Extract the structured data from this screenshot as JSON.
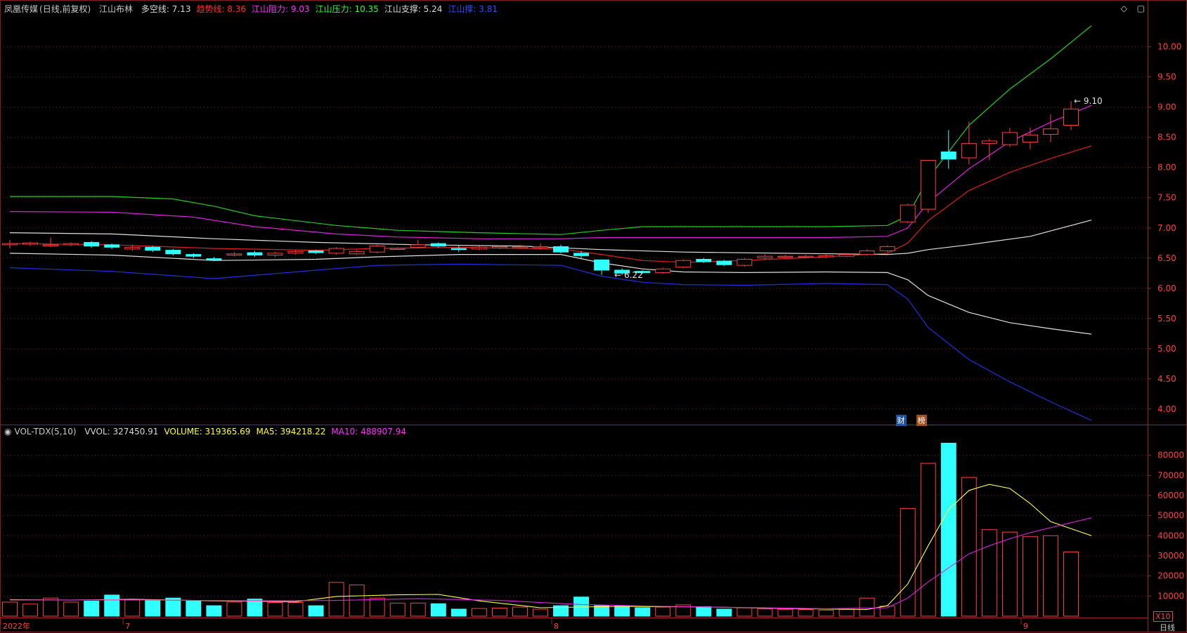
{
  "header": {
    "stock_name": "凤凰传媒",
    "period_mode": "(日线,前复权)",
    "indicator_name": "江山布林",
    "items": [
      {
        "label": "多空线:",
        "value": "7.13",
        "color": "#d8d8d8"
      },
      {
        "label": "趋势线:",
        "value": "8.36",
        "color": "#ff3030"
      },
      {
        "label": "江山阻力:",
        "value": "9.03",
        "color": "#ff30ff"
      },
      {
        "label": "江山压力:",
        "value": "10.35",
        "color": "#30ff30"
      },
      {
        "label": "江山支撑:",
        "value": "5.24",
        "color": "#d8d8d8"
      },
      {
        "label": "江山撑:",
        "value": "3.81",
        "color": "#3050ff"
      }
    ]
  },
  "vol_header": {
    "name": "VOL-TDX(5,10)",
    "items": [
      {
        "label": "VVOL:",
        "value": "327450.91",
        "color": "#d8d8d8"
      },
      {
        "label": "VOLUME:",
        "value": "319365.69",
        "color": "#ffff30"
      },
      {
        "label": "MA5:",
        "value": "394218.22",
        "color": "#ffff30"
      },
      {
        "label": "MA10:",
        "value": "488907.94",
        "color": "#ff30ff"
      }
    ]
  },
  "icons": {
    "diamond": "diamond-icon",
    "window": "restore-window-icon"
  },
  "colors": {
    "up": "#ff4040",
    "down": "#30ffff",
    "grid": "#802020",
    "axis_text": "#ff4040"
  },
  "main_axis": {
    "ticks": [
      "10.00",
      "9.50",
      "9.00",
      "8.50",
      "8.00",
      "7.50",
      "7.00",
      "6.50",
      "6.00",
      "5.50",
      "5.00",
      "4.50",
      "4.00"
    ],
    "min": 3.8,
    "max": 10.45
  },
  "vol_axis": {
    "ticks": [
      "80000",
      "70000",
      "60000",
      "50000",
      "40000",
      "30000",
      "20000",
      "10000"
    ],
    "max": 90000,
    "unit_label": "X10"
  },
  "x_axis": {
    "labels": [
      {
        "text": "2022年",
        "bar": 0
      },
      {
        "text": "7",
        "bar": 6
      },
      {
        "text": "8",
        "bar": 27
      },
      {
        "text": "9",
        "bar": 50
      }
    ]
  },
  "period_label": "日线",
  "annotations": {
    "high": "9.10",
    "low": "6.22"
  },
  "event_badges": [
    {
      "text": "财",
      "bar": 43
    },
    {
      "text": "榜",
      "bar": 44
    }
  ],
  "chart_data": {
    "type": "candlestick",
    "bars": [
      {
        "o": 6.72,
        "c": 6.74,
        "h": 6.8,
        "l": 6.66,
        "v": 7000
      },
      {
        "o": 6.73,
        "c": 6.75,
        "h": 6.77,
        "l": 6.7,
        "v": 6000
      },
      {
        "o": 6.72,
        "c": 6.72,
        "h": 6.84,
        "l": 6.68,
        "v": 9000
      },
      {
        "o": 6.72,
        "c": 6.74,
        "h": 6.76,
        "l": 6.7,
        "v": 7000
      },
      {
        "o": 6.76,
        "c": 6.7,
        "h": 6.78,
        "l": 6.67,
        "v": 7500
      },
      {
        "o": 6.72,
        "c": 6.68,
        "h": 6.74,
        "l": 6.65,
        "v": 10500
      },
      {
        "o": 6.65,
        "c": 6.68,
        "h": 6.72,
        "l": 6.62,
        "v": 8000
      },
      {
        "o": 6.68,
        "c": 6.63,
        "h": 6.7,
        "l": 6.6,
        "v": 7800
      },
      {
        "o": 6.63,
        "c": 6.57,
        "h": 6.65,
        "l": 6.54,
        "v": 9000
      },
      {
        "o": 6.56,
        "c": 6.53,
        "h": 6.58,
        "l": 6.5,
        "v": 7600
      },
      {
        "o": 6.49,
        "c": 6.48,
        "h": 6.52,
        "l": 6.45,
        "v": 5200
      },
      {
        "o": 6.55,
        "c": 6.57,
        "h": 6.6,
        "l": 6.53,
        "v": 7000
      },
      {
        "o": 6.59,
        "c": 6.55,
        "h": 6.62,
        "l": 6.52,
        "v": 8500
      },
      {
        "o": 6.55,
        "c": 6.58,
        "h": 6.6,
        "l": 6.52,
        "v": 6800
      },
      {
        "o": 6.58,
        "c": 6.61,
        "h": 6.63,
        "l": 6.56,
        "v": 6800
      },
      {
        "o": 6.62,
        "c": 6.59,
        "h": 6.64,
        "l": 6.57,
        "v": 5200
      },
      {
        "o": 6.58,
        "c": 6.66,
        "h": 6.68,
        "l": 6.56,
        "v": 16800
      },
      {
        "o": 6.57,
        "c": 6.61,
        "h": 6.64,
        "l": 6.55,
        "v": 15500
      },
      {
        "o": 6.6,
        "c": 6.7,
        "h": 6.72,
        "l": 6.58,
        "v": 9000
      },
      {
        "o": 6.66,
        "c": 6.66,
        "h": 6.68,
        "l": 6.64,
        "v": 6500
      },
      {
        "o": 6.68,
        "c": 6.72,
        "h": 6.8,
        "l": 6.66,
        "v": 6500
      },
      {
        "o": 6.74,
        "c": 6.7,
        "h": 6.76,
        "l": 6.67,
        "v": 6200
      },
      {
        "o": 6.66,
        "c": 6.64,
        "h": 6.72,
        "l": 6.6,
        "v": 3500
      },
      {
        "o": 6.65,
        "c": 6.68,
        "h": 6.7,
        "l": 6.63,
        "v": 3800
      },
      {
        "o": 6.67,
        "c": 6.69,
        "h": 6.71,
        "l": 6.65,
        "v": 4000
      },
      {
        "o": 6.69,
        "c": 6.69,
        "h": 6.72,
        "l": 6.66,
        "v": 4500
      },
      {
        "o": 6.69,
        "c": 6.69,
        "h": 6.74,
        "l": 6.64,
        "v": 3500
      },
      {
        "o": 6.69,
        "c": 6.6,
        "h": 6.72,
        "l": 6.58,
        "v": 5200
      },
      {
        "o": 6.58,
        "c": 6.54,
        "h": 6.62,
        "l": 6.48,
        "v": 9500
      },
      {
        "o": 6.47,
        "c": 6.3,
        "h": 6.48,
        "l": 6.22,
        "v": 5200
      },
      {
        "o": 6.3,
        "c": 6.25,
        "h": 6.33,
        "l": 6.22,
        "v": 5000
      },
      {
        "o": 6.28,
        "c": 6.26,
        "h": 6.3,
        "l": 6.24,
        "v": 4200
      },
      {
        "o": 6.26,
        "c": 6.32,
        "h": 6.34,
        "l": 6.24,
        "v": 4500
      },
      {
        "o": 6.35,
        "c": 6.46,
        "h": 6.48,
        "l": 6.33,
        "v": 5600
      },
      {
        "o": 6.48,
        "c": 6.44,
        "h": 6.5,
        "l": 6.42,
        "v": 4700
      },
      {
        "o": 6.45,
        "c": 6.39,
        "h": 6.47,
        "l": 6.37,
        "v": 3500
      },
      {
        "o": 6.38,
        "c": 6.48,
        "h": 6.5,
        "l": 6.36,
        "v": 4200
      },
      {
        "o": 6.5,
        "c": 6.53,
        "h": 6.56,
        "l": 6.48,
        "v": 3600
      },
      {
        "o": 6.52,
        "c": 6.53,
        "h": 6.55,
        "l": 6.5,
        "v": 3400
      },
      {
        "o": 6.52,
        "c": 6.53,
        "h": 6.55,
        "l": 6.5,
        "v": 3300
      },
      {
        "o": 6.52,
        "c": 6.54,
        "h": 6.56,
        "l": 6.5,
        "v": 3000
      },
      {
        "o": 6.53,
        "c": 6.56,
        "h": 6.58,
        "l": 6.52,
        "v": 3400
      },
      {
        "o": 6.56,
        "c": 6.62,
        "h": 6.64,
        "l": 6.54,
        "v": 9000
      },
      {
        "o": 6.62,
        "c": 6.69,
        "h": 6.71,
        "l": 6.6,
        "v": 5000
      },
      {
        "o": 7.1,
        "c": 7.38,
        "h": 7.4,
        "l": 7.08,
        "v": 53500
      },
      {
        "o": 7.31,
        "c": 8.12,
        "h": 8.12,
        "l": 7.25,
        "v": 76000
      },
      {
        "o": 8.26,
        "c": 8.14,
        "h": 8.62,
        "l": 7.98,
        "v": 86000
      },
      {
        "o": 8.16,
        "c": 8.4,
        "h": 8.76,
        "l": 8.05,
        "v": 69000
      },
      {
        "o": 8.4,
        "c": 8.44,
        "h": 8.48,
        "l": 8.12,
        "v": 43000
      },
      {
        "o": 8.38,
        "c": 8.58,
        "h": 8.66,
        "l": 8.34,
        "v": 41800
      },
      {
        "o": 8.42,
        "c": 8.54,
        "h": 8.66,
        "l": 8.3,
        "v": 39500
      },
      {
        "o": 8.55,
        "c": 8.64,
        "h": 8.88,
        "l": 8.42,
        "v": 40000
      },
      {
        "o": 8.7,
        "c": 8.97,
        "h": 9.1,
        "l": 8.62,
        "v": 31900
      }
    ],
    "lines": {
      "duokong": [
        [
          0,
          6.92
        ],
        [
          5,
          6.9
        ],
        [
          10,
          6.82
        ],
        [
          15,
          6.76
        ],
        [
          20,
          6.72
        ],
        [
          25,
          6.7
        ],
        [
          29,
          6.64
        ],
        [
          33,
          6.6
        ],
        [
          38,
          6.58
        ],
        [
          43,
          6.56
        ],
        [
          44,
          6.58
        ],
        [
          45,
          6.64
        ],
        [
          47,
          6.72
        ],
        [
          50,
          6.86
        ],
        [
          53,
          7.13
        ]
      ],
      "quyu": [
        [
          0,
          6.74
        ],
        [
          5,
          6.72
        ],
        [
          10,
          6.66
        ],
        [
          15,
          6.63
        ],
        [
          18,
          6.66
        ],
        [
          22,
          6.68
        ],
        [
          27,
          6.65
        ],
        [
          29,
          6.56
        ],
        [
          31,
          6.46
        ],
        [
          33,
          6.43
        ],
        [
          36,
          6.46
        ],
        [
          40,
          6.52
        ],
        [
          43,
          6.58
        ],
        [
          44,
          6.75
        ],
        [
          45,
          7.12
        ],
        [
          47,
          7.62
        ],
        [
          49,
          7.92
        ],
        [
          51,
          8.15
        ],
        [
          53,
          8.36
        ]
      ],
      "zuli": [
        [
          0,
          7.27
        ],
        [
          5,
          7.26
        ],
        [
          9,
          7.18
        ],
        [
          12,
          7.02
        ],
        [
          16,
          6.9
        ],
        [
          19,
          6.85
        ],
        [
          23,
          6.82
        ],
        [
          27,
          6.82
        ],
        [
          29,
          6.84
        ],
        [
          31,
          6.84
        ],
        [
          35,
          6.84
        ],
        [
          40,
          6.84
        ],
        [
          43,
          6.86
        ],
        [
          44,
          7.0
        ],
        [
          45,
          7.42
        ],
        [
          47,
          7.98
        ],
        [
          49,
          8.43
        ],
        [
          51,
          8.75
        ],
        [
          53,
          9.03
        ]
      ],
      "yali": [
        [
          0,
          7.52
        ],
        [
          5,
          7.52
        ],
        [
          8,
          7.48
        ],
        [
          10,
          7.36
        ],
        [
          12,
          7.2
        ],
        [
          16,
          7.04
        ],
        [
          19,
          6.96
        ],
        [
          23,
          6.92
        ],
        [
          27,
          6.89
        ],
        [
          29,
          6.96
        ],
        [
          31,
          7.02
        ],
        [
          35,
          7.02
        ],
        [
          40,
          7.02
        ],
        [
          43,
          7.04
        ],
        [
          44,
          7.2
        ],
        [
          45,
          7.82
        ],
        [
          47,
          8.7
        ],
        [
          49,
          9.3
        ],
        [
          51,
          9.8
        ],
        [
          53,
          10.35
        ]
      ],
      "zhicheng": [
        [
          0,
          6.58
        ],
        [
          5,
          6.55
        ],
        [
          10,
          6.46
        ],
        [
          15,
          6.48
        ],
        [
          18,
          6.52
        ],
        [
          22,
          6.56
        ],
        [
          27,
          6.56
        ],
        [
          29,
          6.42
        ],
        [
          31,
          6.32
        ],
        [
          33,
          6.27
        ],
        [
          36,
          6.26
        ],
        [
          40,
          6.27
        ],
        [
          43,
          6.26
        ],
        [
          44,
          6.14
        ],
        [
          45,
          5.88
        ],
        [
          47,
          5.6
        ],
        [
          49,
          5.43
        ],
        [
          51,
          5.33
        ],
        [
          53,
          5.24
        ]
      ],
      "cheng": [
        [
          0,
          6.34
        ],
        [
          5,
          6.28
        ],
        [
          10,
          6.16
        ],
        [
          15,
          6.3
        ],
        [
          18,
          6.38
        ],
        [
          22,
          6.4
        ],
        [
          27,
          6.38
        ],
        [
          29,
          6.2
        ],
        [
          31,
          6.1
        ],
        [
          33,
          6.06
        ],
        [
          36,
          6.05
        ],
        [
          40,
          6.08
        ],
        [
          43,
          6.06
        ],
        [
          44,
          5.82
        ],
        [
          45,
          5.35
        ],
        [
          47,
          4.82
        ],
        [
          49,
          4.45
        ],
        [
          51,
          4.12
        ],
        [
          53,
          3.81
        ]
      ],
      "ma5": [
        [
          0,
          8200
        ],
        [
          3,
          8000
        ],
        [
          6,
          8400
        ],
        [
          10,
          7600
        ],
        [
          14,
          7200
        ],
        [
          16,
          9800
        ],
        [
          19,
          10600
        ],
        [
          21,
          10800
        ],
        [
          23,
          7600
        ],
        [
          26,
          4200
        ],
        [
          30,
          4900
        ],
        [
          34,
          4600
        ],
        [
          38,
          3800
        ],
        [
          42,
          3300
        ],
        [
          43,
          5200
        ],
        [
          44,
          16000
        ],
        [
          45,
          35000
        ],
        [
          46,
          53000
        ],
        [
          47,
          62500
        ],
        [
          48,
          65500
        ],
        [
          49,
          63500
        ],
        [
          50,
          56000
        ],
        [
          51,
          47000
        ],
        [
          53,
          40000
        ]
      ],
      "ma10": [
        [
          0,
          8000
        ],
        [
          6,
          8100
        ],
        [
          12,
          7600
        ],
        [
          16,
          7800
        ],
        [
          20,
          8700
        ],
        [
          24,
          7800
        ],
        [
          28,
          5800
        ],
        [
          32,
          4900
        ],
        [
          36,
          4300
        ],
        [
          40,
          3700
        ],
        [
          43,
          4200
        ],
        [
          44,
          9000
        ],
        [
          45,
          17000
        ],
        [
          46,
          24000
        ],
        [
          47,
          31000
        ],
        [
          48,
          35000
        ],
        [
          49,
          38500
        ],
        [
          50,
          41500
        ],
        [
          51,
          44000
        ],
        [
          53,
          48900
        ]
      ]
    }
  }
}
